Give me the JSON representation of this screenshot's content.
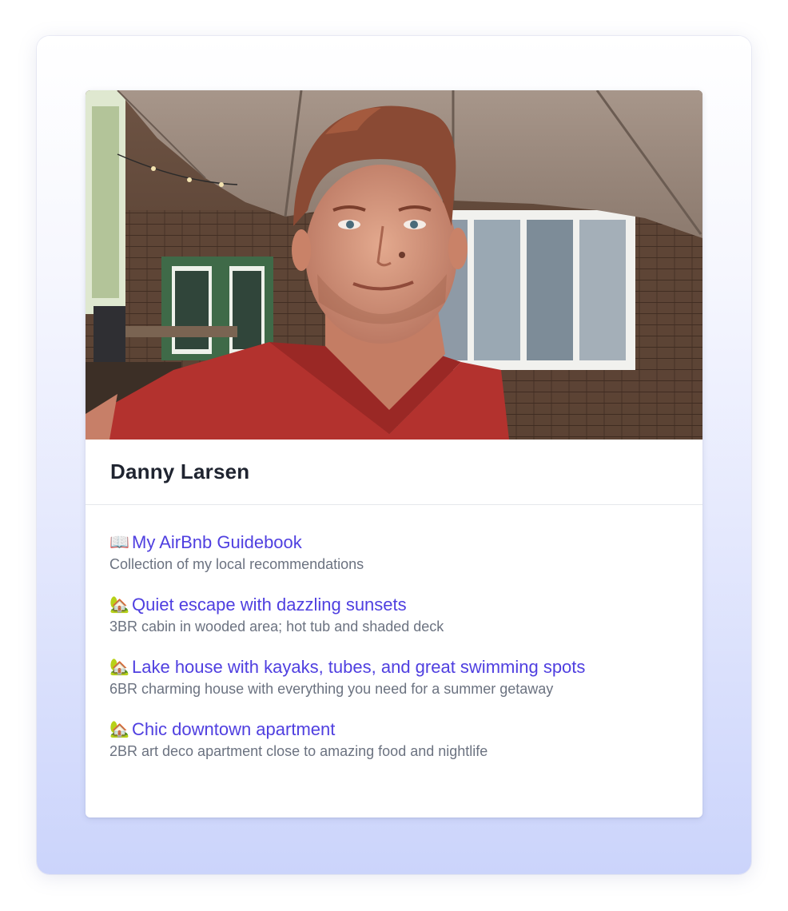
{
  "profile": {
    "name": "Danny Larsen",
    "photo_icon": "profile-photo"
  },
  "links": [
    {
      "icon": "📖",
      "icon_name": "book-icon",
      "title": "My AirBnb Guidebook",
      "description": "Collection of my local recommendations"
    },
    {
      "icon": "🏡",
      "icon_name": "house-icon",
      "title": "Quiet escape with dazzling sunsets",
      "description": "3BR cabin in wooded area; hot tub and shaded deck"
    },
    {
      "icon": "🏡",
      "icon_name": "house-icon",
      "title": "Lake house with kayaks, tubes, and great swimming spots",
      "description": "6BR charming house with everything you need for a summer getaway"
    },
    {
      "icon": "🏡",
      "icon_name": "house-icon",
      "title": "Chic downtown apartment",
      "description": "2BR art deco apartment close to amazing food and nightlife"
    }
  ],
  "colors": {
    "link": "#4f3fe0",
    "description": "#6b7280",
    "name": "#1f2430"
  }
}
